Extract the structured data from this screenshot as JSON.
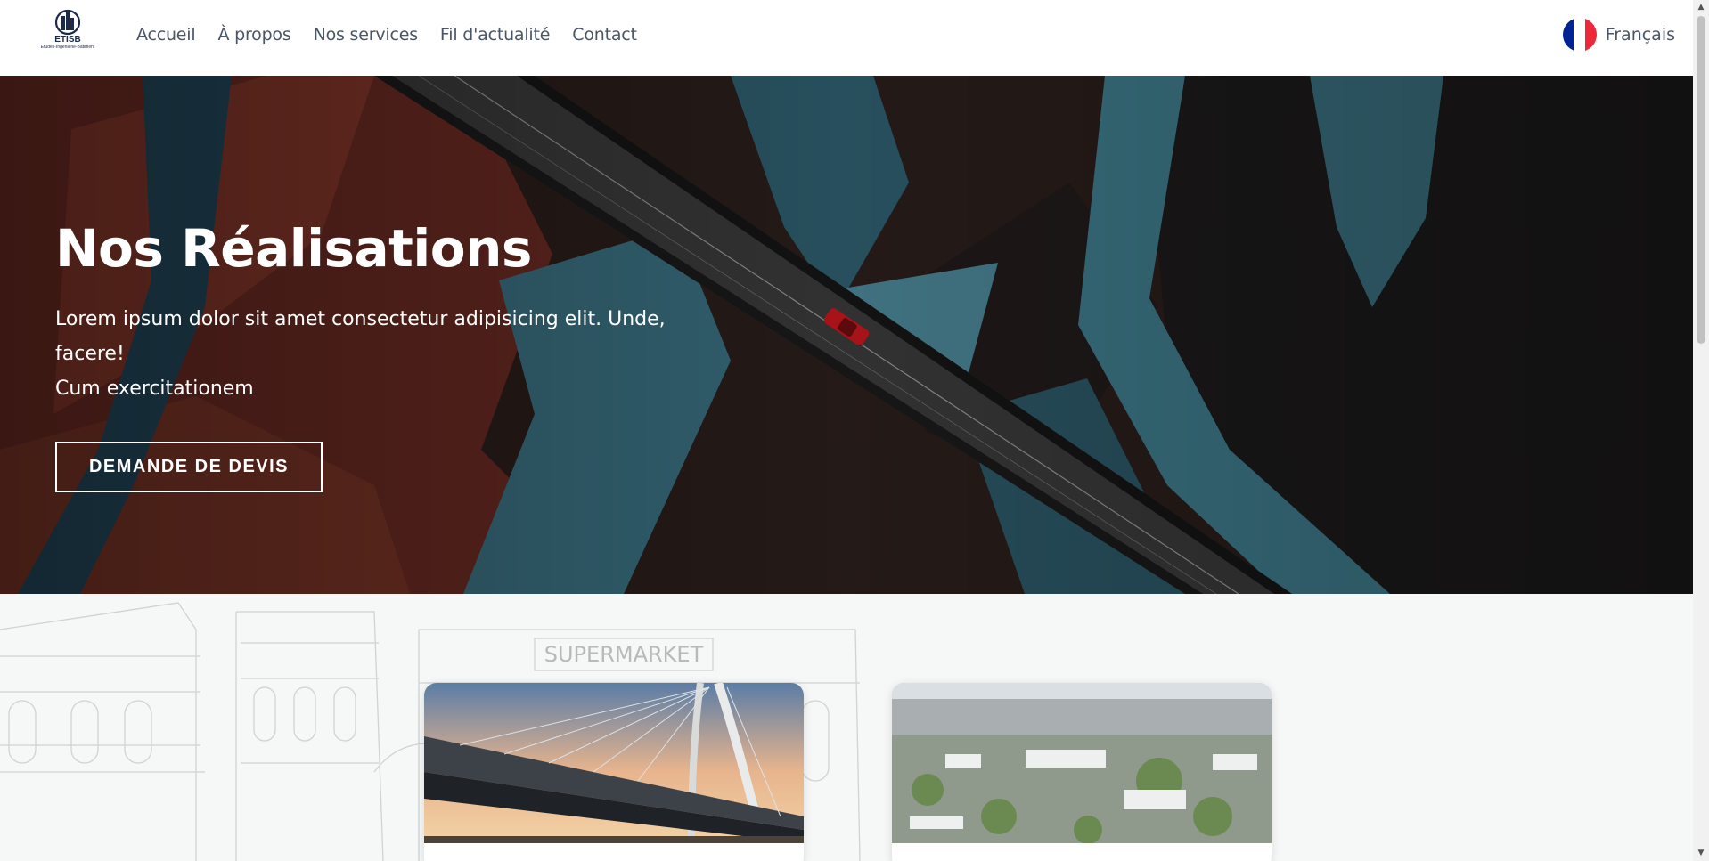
{
  "nav": {
    "logo_text": "ETISB",
    "logo_sub": "Etudes-Ingénierie-Bâtiment",
    "links": [
      "Accueil",
      "À propos",
      "Nos services",
      "Fil d'actualité",
      "Contact"
    ],
    "language": "Français"
  },
  "hero": {
    "title": "Nos Réalisations",
    "subtitle_line1": "Lorem ipsum dolor sit amet consectetur adipisicing elit. Unde, facere!",
    "subtitle_line2": "Cum exercitationem",
    "cta": "DEMANDE DE DEVIS"
  },
  "sketch": {
    "sign": "SUPERMARKET"
  },
  "cards": [
    {
      "image": "cable-stayed bridge at sunset"
    },
    {
      "image": "aerial city view"
    }
  ],
  "colors": {
    "nav_text": "#4a5568",
    "hero_text": "#ffffff",
    "flag_blue": "#002395",
    "flag_white": "#ffffff",
    "flag_red": "#ed2939",
    "section_bg": "#f6f7f7"
  }
}
